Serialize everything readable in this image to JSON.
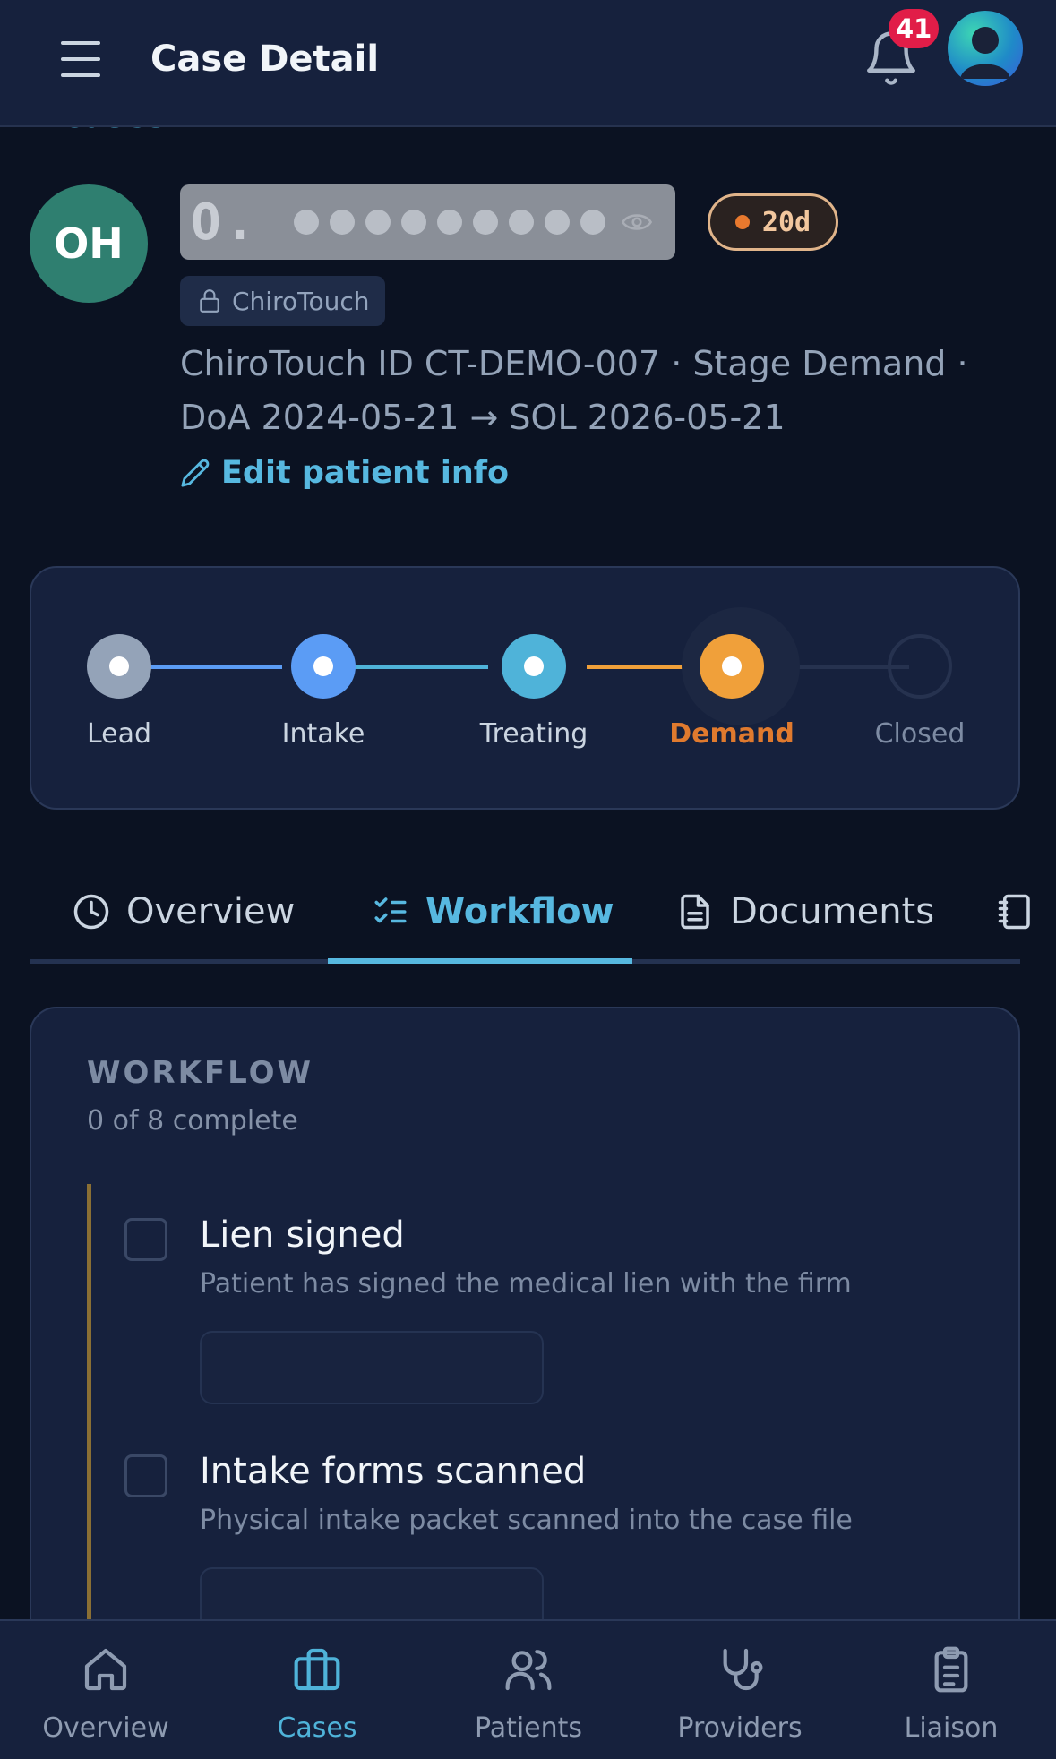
{
  "header": {
    "title": "Case Detail",
    "notification_count": "41"
  },
  "back_link": {
    "label": "Cases"
  },
  "patient": {
    "initials": "OH",
    "masked_initial": "O.",
    "days_badge": "20d",
    "source_chip": "ChiroTouch",
    "meta_line_1": "ChiroTouch ID CT-DEMO-007 · Stage Demand ·",
    "meta_line_2": "DoA 2024-05-21 → SOL 2026-05-21",
    "edit_label": "Edit patient info"
  },
  "stages": [
    {
      "label": "Lead",
      "color": "#94a3b8",
      "state": "done"
    },
    {
      "label": "Intake",
      "color": "#5b9cf5",
      "state": "done"
    },
    {
      "label": "Treating",
      "color": "#4fb3d9",
      "state": "done"
    },
    {
      "label": "Demand",
      "color": "#f0a03a",
      "state": "current"
    },
    {
      "label": "Closed",
      "color": "#2a3858",
      "state": "future"
    }
  ],
  "tabs": [
    {
      "label": "Overview",
      "icon": "clock-icon",
      "active": false
    },
    {
      "label": "Workflow",
      "icon": "checklist-icon",
      "active": true
    },
    {
      "label": "Documents",
      "icon": "document-icon",
      "active": false
    },
    {
      "label": "",
      "icon": "notebook-icon",
      "active": false
    }
  ],
  "workflow": {
    "title": "WORKFLOW",
    "progress": "0 of 8 complete",
    "items": [
      {
        "title": "Lien signed",
        "desc": "Patient has signed the medical lien with the firm",
        "checked": false
      },
      {
        "title": "Intake forms scanned",
        "desc": "Physical intake packet scanned into the case file",
        "checked": false
      }
    ]
  },
  "bottom_nav": [
    {
      "label": "Overview",
      "icon": "home-icon",
      "active": false
    },
    {
      "label": "Cases",
      "icon": "briefcase-icon",
      "active": true
    },
    {
      "label": "Patients",
      "icon": "users-icon",
      "active": false
    },
    {
      "label": "Providers",
      "icon": "stethoscope-icon",
      "active": false
    },
    {
      "label": "Liaison",
      "icon": "clipboard-icon",
      "active": false
    }
  ],
  "colors": {
    "accent": "#57b8e0",
    "background": "#0b1222",
    "surface": "#16213d",
    "badge_red": "#e11d48",
    "demand_orange": "#f0a03a"
  }
}
